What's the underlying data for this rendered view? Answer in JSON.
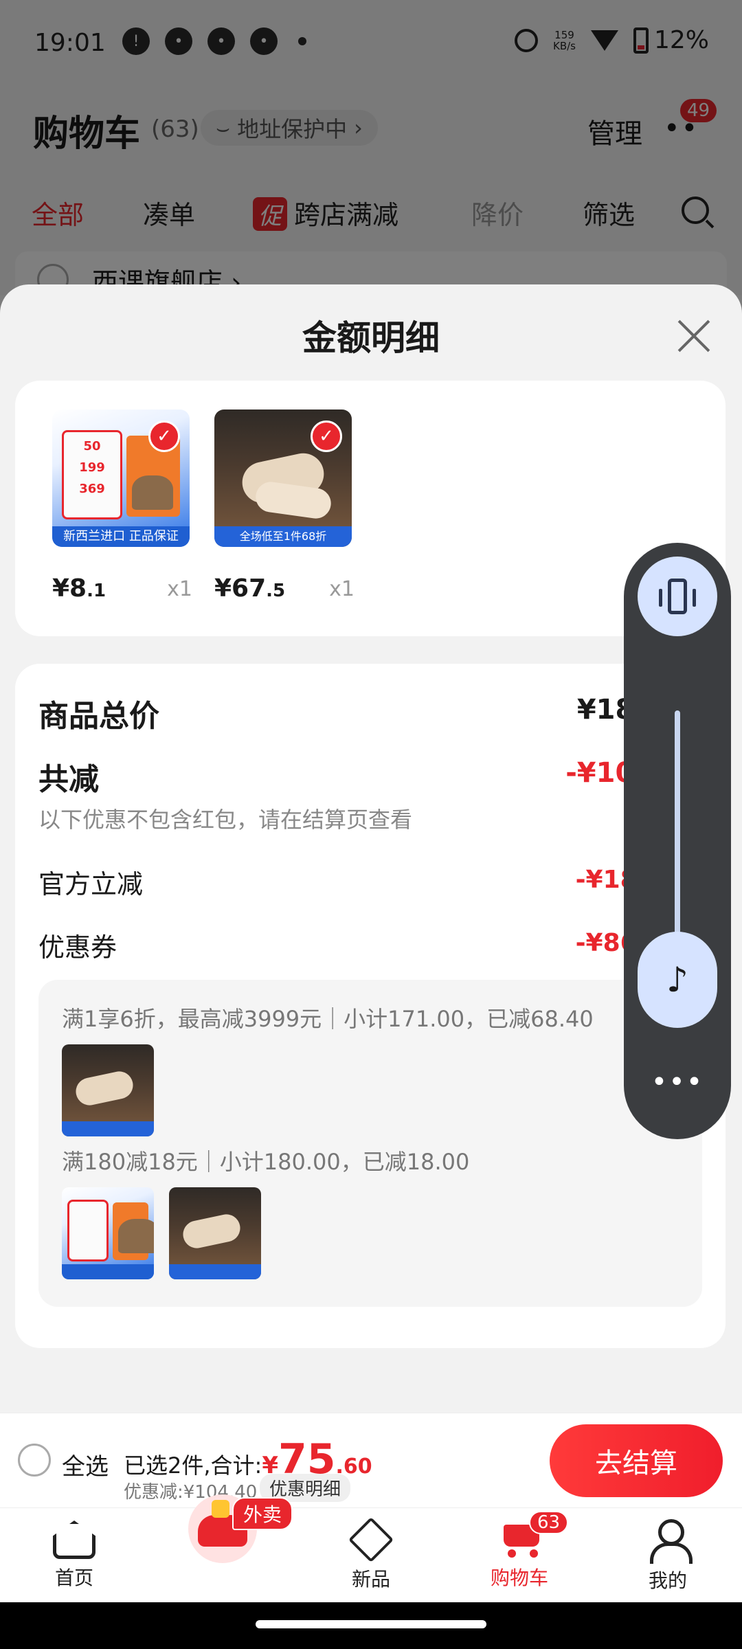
{
  "status_bar": {
    "time": "19:01",
    "net_speed_value": "159",
    "net_speed_unit": "KB/s",
    "battery": "12%"
  },
  "cart_header": {
    "title": "购物车",
    "count": "(63)",
    "address_protect": "地址保护中",
    "manage": "管理",
    "badge": "49"
  },
  "filter_tabs": {
    "all": "全部",
    "bundle": "凑单",
    "promo_tag": "促",
    "cross_store": "跨店满减",
    "price_drop": "降价",
    "filter": "筛选"
  },
  "store_row": {
    "name": "西课旗舰店 ›"
  },
  "sheet": {
    "title": "金额明细",
    "products": [
      {
        "price_int": "¥8",
        "price_dec": ".1",
        "qty": "x1",
        "banner": "新西兰进口 正品保证"
      },
      {
        "price_int": "¥67",
        "price_dec": ".5",
        "qty": "x1",
        "banner": "全场低至1件68折"
      }
    ],
    "food_labels": [
      "50",
      "199",
      "369"
    ],
    "total_label": "商品总价",
    "total_value": "¥180.00",
    "reduce_label": "共减",
    "reduce_value": "-¥104.40",
    "reduce_note": "以下优惠不包含红包，请在结算页查看",
    "official_label": "官方立减",
    "official_value": "-¥18.00 ˅",
    "coupon_label": "优惠券",
    "coupon_value": "-¥86.40 ˄",
    "promo_line_1": "满1享6折，最高减3999元｜小计171.00，已减68.40",
    "promo_line_2": "满180减18元｜小计180.00，已减18.00"
  },
  "volume_panel": {
    "more": "•••",
    "music_glyph": "♪"
  },
  "checkout": {
    "select_all": "全选",
    "selected_prefix": "已选2件,合计:",
    "total_symbol": "¥",
    "total_int": "75",
    "total_dec": ".60",
    "saved": "优惠减:¥104.40",
    "detail": "优惠明细",
    "button": "去结算"
  },
  "bottom_nav": {
    "home": "首页",
    "waimai": "外卖",
    "new": "新品",
    "cart": "购物车",
    "cart_badge": "63",
    "mine": "我的"
  }
}
